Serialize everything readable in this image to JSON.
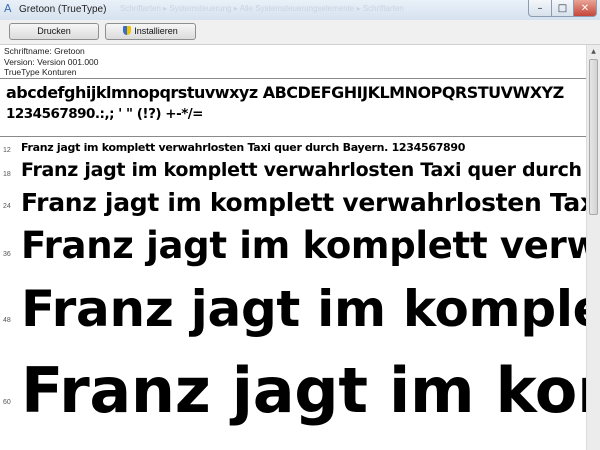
{
  "window": {
    "title": "Gretoon (TrueType)",
    "title_ghost": "Schriftarten  ▸  Systemsteuerung  ▸  Alle Systemsteuerungselemente  ▸  Schriftarten",
    "min_glyph": "–",
    "max_glyph": "□",
    "close_glyph": "✕"
  },
  "toolbar": {
    "print_label": "Drucken",
    "install_label": "Installieren"
  },
  "info": {
    "font_name": "Schriftname: Gretoon",
    "version": "Version: Version 001.000",
    "outline": "TrueType Konturen"
  },
  "charset": {
    "letters": "abcdefghijklmnopqrstuvwxyz ABCDEFGHIJKLMNOPQRSTUVWXYZ",
    "numbers": "1234567890.:,; ' \" (!?) +-*/="
  },
  "samples": [
    {
      "size": "12",
      "text": "Franz jagt im komplett verwahrlosten Taxi quer durch Bayern. 1234567890"
    },
    {
      "size": "18",
      "text": "Franz jagt im komplett verwahrlosten Taxi quer durch Bayern."
    },
    {
      "size": "24",
      "text": "Franz jagt im komplett verwahrlosten Taxi quer durch"
    },
    {
      "size": "36",
      "text": "Franz jagt im komplett verwahrlosten"
    },
    {
      "size": "48",
      "text": "Franz jagt im komplett"
    },
    {
      "size": "60",
      "text": "Franz jagt im komplett"
    }
  ],
  "colors": {
    "background": "#ffffff",
    "titlebar": "#d6e2ef",
    "close_button": "#c4463a",
    "toolbar": "#f0f0f0"
  },
  "icons": {
    "app": "font-file-icon",
    "install": "uac-shield-icon"
  }
}
